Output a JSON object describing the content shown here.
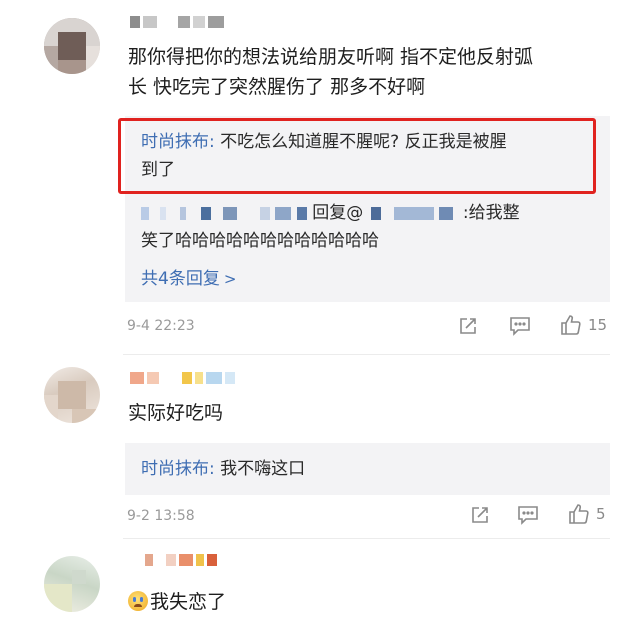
{
  "comments": [
    {
      "body_line1": "那你得把你的想法说给朋友听啊 指不定他反射弧",
      "body_line2": "长 快吃完了突然腥伤了 那多不好啊",
      "replies": {
        "highlighted": {
          "author": "时尚抹布:",
          "line1": " 不吃怎么知道腥不腥呢? 反正我是被腥",
          "line2": "到了"
        },
        "second": {
          "mid_text": "回复@",
          "tail_text": ":给我整",
          "line2": "笑了哈哈哈哈哈哈哈哈哈哈哈哈"
        },
        "more_label": "共4条回复",
        "more_arrow": ">"
      },
      "time": "9-4 22:23",
      "like_count": "15"
    },
    {
      "body_line1": "实际好吃吗",
      "replies": {
        "highlighted": {
          "author": "时尚抹布:",
          "line1": " 我不嗨这口"
        }
      },
      "time": "9-2 13:58",
      "like_count": "5"
    },
    {
      "body_line1": "我失恋了",
      "emoji": "crying-face-emoji"
    }
  ],
  "icons": [
    "share-icon",
    "comment-icon",
    "like-icon"
  ],
  "colors": {
    "author_blue": "#3f6eb3",
    "highlight_red": "#e0221f",
    "reply_bg": "#f3f3f5",
    "meta_grey": "#9a9a9a"
  }
}
